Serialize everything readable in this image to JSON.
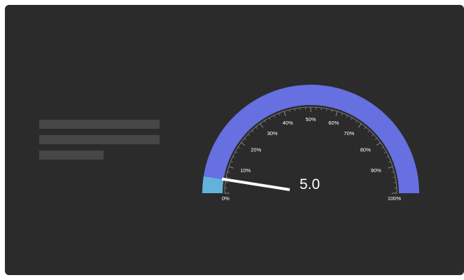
{
  "chart_data": {
    "type": "gauge",
    "value": 5.0,
    "value_label": "5.0",
    "min": 0,
    "max": 100,
    "bands": [
      {
        "from": 0,
        "to": 5.0,
        "color": "#63b2dc"
      },
      {
        "from": 5.0,
        "to": 100,
        "color": "#6670e0"
      }
    ],
    "tick_labels": [
      "0%",
      "10%",
      "20%",
      "30%",
      "40%",
      "50%",
      "60%",
      "70%",
      "80%",
      "90%",
      "100%"
    ],
    "minor_ticks_per_major": 5
  },
  "colors": {
    "background": "#2b2b2b",
    "progress": "#63b2dc",
    "track": "#6670e0",
    "needle": "#ffffff",
    "placeholder": "#474747"
  }
}
